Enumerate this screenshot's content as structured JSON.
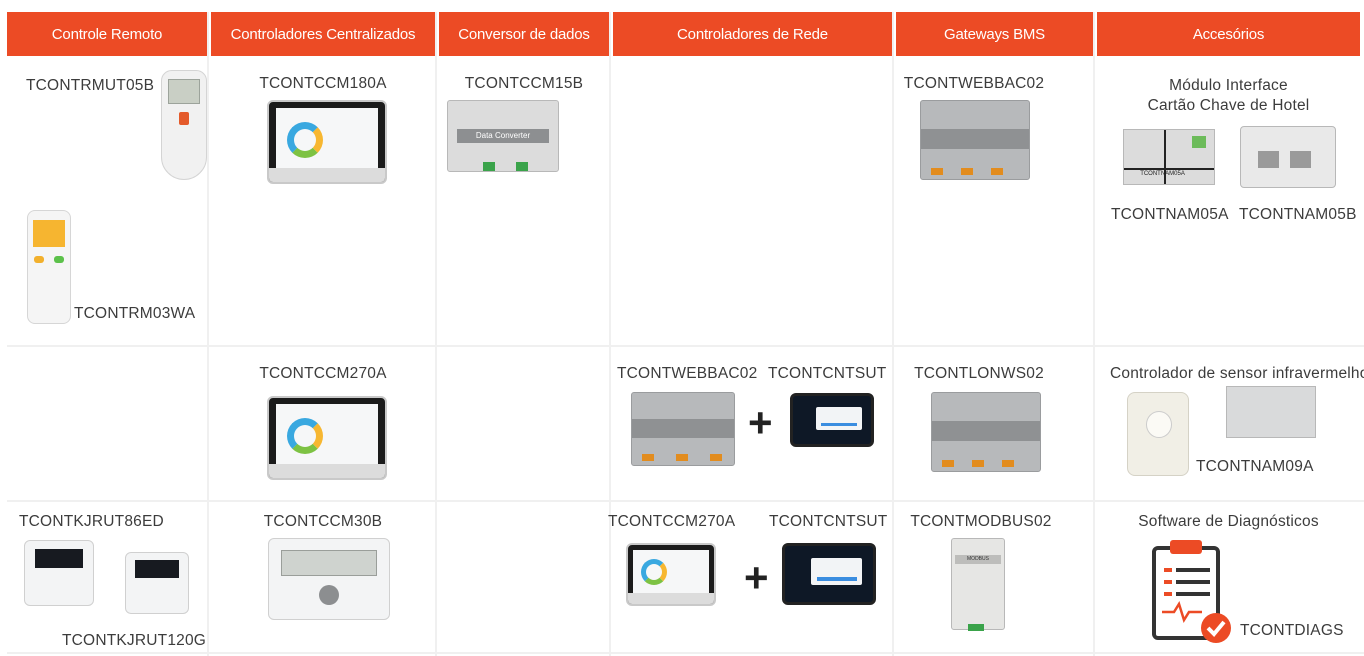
{
  "headers": [
    "Controle Remoto",
    "Controladores Centralizados",
    "Conversor de dados",
    "Controladores de Rede",
    "Gateways BMS",
    "Accesórios"
  ],
  "row1": {
    "remote_a": "TCONTRMUT05B",
    "remote_b": "TCONTRM03WA",
    "central_a": "TCONTCCM180A",
    "converter": "TCONTCCM15B",
    "converter_screen_text": "Data Converter",
    "bms_a": "TCONTWEBBAC02",
    "accessory_title_line1": "Módulo Interface",
    "accessory_title_line2": "Cartão Chave de Hotel",
    "accessory_a": "TCONTNAM05A",
    "accessory_b": "TCONTNAM05B",
    "module_print": "TCONTNAM05A"
  },
  "row2": {
    "central": "TCONTCCM270A",
    "network_a": "TCONTWEBBAC02",
    "network_b": "TCONTCNTSUT",
    "plus": "+",
    "bms": "TCONTLONWS02",
    "accessory_title": "Controlador de sensor infravermelho",
    "accessory": "TCONTNAM09A"
  },
  "row3": {
    "wall_a": "TCONTKJRUT86ED",
    "wall_b": "TCONTKJRUT120G",
    "central": "TCONTCCM30B",
    "network_a": "TCONTCCM270A",
    "network_b": "TCONTCNTSUT",
    "plus": "+",
    "bms": "TCONTMODBUS02",
    "bms_box_label": "MODBUS GATEWAY",
    "accessory_title": "Software de Diagnósticos",
    "accessory": "TCONTDIAGS"
  },
  "colors": {
    "header_bg": "#ec4b25",
    "header_text": "#ffffff",
    "grid_line": "#f0f0f0",
    "label_text": "#3c3c3c"
  },
  "icons": [
    "remote-control-icon",
    "touch-panel-icon",
    "gateway-icon",
    "plus-icon",
    "clipboard-check-icon"
  ]
}
